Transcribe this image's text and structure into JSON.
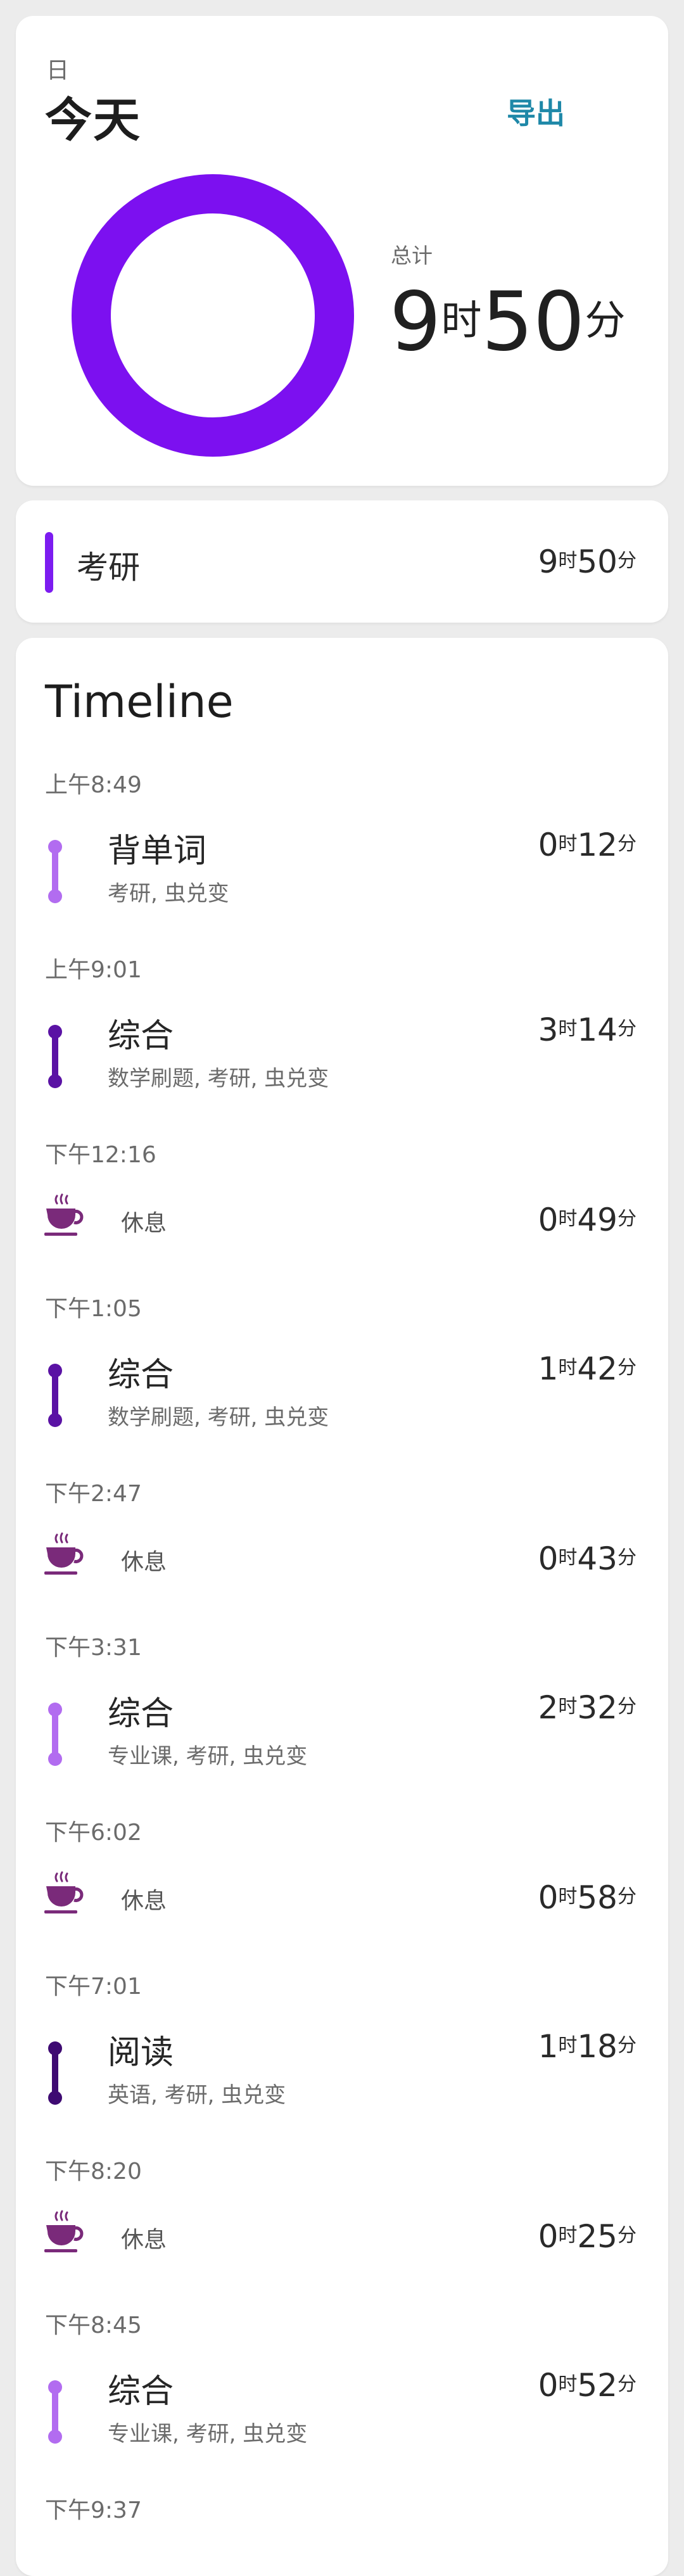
{
  "summary": {
    "period": "日",
    "day": "今天",
    "export_label": "导出",
    "total_label": "总计",
    "total_hours": "9",
    "total_hours_unit": "时",
    "total_minutes": "50",
    "total_minutes_unit": "分",
    "ring_color": "#7c10f0"
  },
  "category": {
    "name": "考研",
    "hours": "9",
    "minutes": "50",
    "color": "#7c1cf0"
  },
  "units": {
    "h": "时",
    "m": "分"
  },
  "timeline": {
    "title": "Timeline",
    "entries": [
      {
        "time": "上午8:49",
        "type": "task",
        "title": "背单词",
        "tags": "考研, 虫兑变",
        "hours": "0",
        "minutes": "12",
        "color": "#b26cf0"
      },
      {
        "time": "上午9:01",
        "type": "task",
        "title": "综合",
        "tags": "数学刷题, 考研, 虫兑变",
        "hours": "3",
        "minutes": "14",
        "color": "#5a12a4"
      },
      {
        "time": "下午12:16",
        "type": "rest",
        "title": "休息",
        "hours": "0",
        "minutes": "49"
      },
      {
        "time": "下午1:05",
        "type": "task",
        "title": "综合",
        "tags": "数学刷题, 考研, 虫兑变",
        "hours": "1",
        "minutes": "42",
        "color": "#5a12a4"
      },
      {
        "time": "下午2:47",
        "type": "rest",
        "title": "休息",
        "hours": "0",
        "minutes": "43"
      },
      {
        "time": "下午3:31",
        "type": "task",
        "title": "综合",
        "tags": "专业课, 考研, 虫兑变",
        "hours": "2",
        "minutes": "32",
        "color": "#b26cf0"
      },
      {
        "time": "下午6:02",
        "type": "rest",
        "title": "休息",
        "hours": "0",
        "minutes": "58"
      },
      {
        "time": "下午7:01",
        "type": "task",
        "title": "阅读",
        "tags": "英语, 考研, 虫兑变",
        "hours": "1",
        "minutes": "18",
        "color": "#3e0a72"
      },
      {
        "time": "下午8:20",
        "type": "rest",
        "title": "休息",
        "hours": "0",
        "minutes": "25"
      },
      {
        "time": "下午8:45",
        "type": "task",
        "title": "综合",
        "tags": "专业课, 考研, 虫兑变",
        "hours": "0",
        "minutes": "52",
        "color": "#b26cf0"
      },
      {
        "time": "下午9:37",
        "type": "label-only"
      }
    ]
  },
  "icons": {
    "rest": "coffee-cup-icon"
  }
}
